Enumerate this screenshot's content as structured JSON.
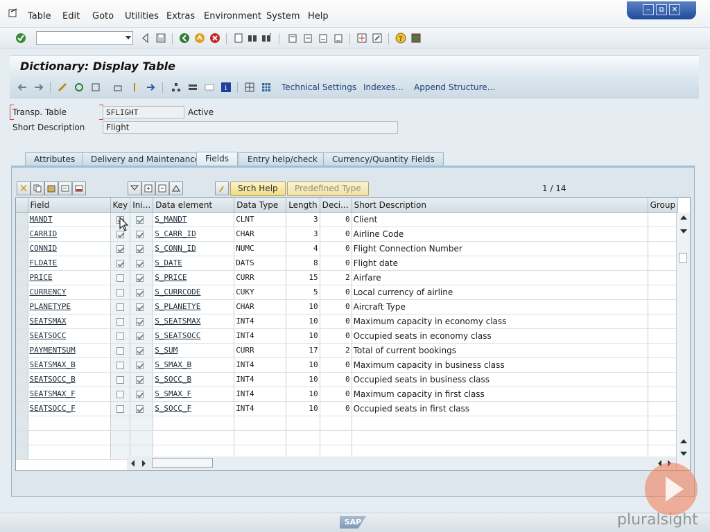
{
  "menu": [
    "Table",
    "Edit",
    "Goto",
    "Utilities",
    "Extras",
    "Environment",
    "System",
    "Help"
  ],
  "window_controls": [
    "‒",
    "⧉",
    "✕"
  ],
  "page_title": "Dictionary: Display Table",
  "app_toolbar": {
    "technical_settings": "Technical Settings",
    "indexes": "Indexes...",
    "append_structure": "Append Structure..."
  },
  "header": {
    "table_type_label": "Transp. Table",
    "table_name": "SFLIGHT",
    "status": "Active",
    "short_desc_label": "Short Description",
    "short_desc": "Flight"
  },
  "tabs": [
    "Attributes",
    "Delivery and Maintenance",
    "Fields",
    "Entry help/check",
    "Currency/Quantity Fields"
  ],
  "active_tab": "Fields",
  "grid_buttons": {
    "search_help": "Srch Help",
    "predefined_type": "Predefined Type"
  },
  "pager": "1 / 14",
  "columns": [
    "Field",
    "Key",
    "Ini...",
    "Data element",
    "Data Type",
    "Length",
    "Deci...",
    "Short Description",
    "Group"
  ],
  "rows": [
    {
      "field": "MANDT",
      "key": true,
      "init": true,
      "element": "S_MANDT",
      "type": "CLNT",
      "length": "3",
      "dec": "0",
      "desc": "Client"
    },
    {
      "field": "CARRID",
      "key": true,
      "init": true,
      "element": "S_CARR_ID",
      "type": "CHAR",
      "length": "3",
      "dec": "0",
      "desc": "Airline Code"
    },
    {
      "field": "CONNID",
      "key": true,
      "init": true,
      "element": "S_CONN_ID",
      "type": "NUMC",
      "length": "4",
      "dec": "0",
      "desc": "Flight Connection Number"
    },
    {
      "field": "FLDATE",
      "key": true,
      "init": true,
      "element": "S_DATE",
      "type": "DATS",
      "length": "8",
      "dec": "0",
      "desc": "Flight date"
    },
    {
      "field": "PRICE",
      "key": false,
      "init": true,
      "element": "S_PRICE",
      "type": "CURR",
      "length": "15",
      "dec": "2",
      "desc": "Airfare"
    },
    {
      "field": "CURRENCY",
      "key": false,
      "init": true,
      "element": "S_CURRCODE",
      "type": "CUKY",
      "length": "5",
      "dec": "0",
      "desc": "Local currency of airline"
    },
    {
      "field": "PLANETYPE",
      "key": false,
      "init": true,
      "element": "S_PLANETYE",
      "type": "CHAR",
      "length": "10",
      "dec": "0",
      "desc": "Aircraft Type"
    },
    {
      "field": "SEATSMAX",
      "key": false,
      "init": true,
      "element": "S_SEATSMAX",
      "type": "INT4",
      "length": "10",
      "dec": "0",
      "desc": "Maximum capacity in economy class"
    },
    {
      "field": "SEATSOCC",
      "key": false,
      "init": true,
      "element": "S_SEATSOCC",
      "type": "INT4",
      "length": "10",
      "dec": "0",
      "desc": "Occupied seats in economy class"
    },
    {
      "field": "PAYMENTSUM",
      "key": false,
      "init": true,
      "element": "S_SUM",
      "type": "CURR",
      "length": "17",
      "dec": "2",
      "desc": "Total of current bookings"
    },
    {
      "field": "SEATSMAX_B",
      "key": false,
      "init": true,
      "element": "S_SMAX_B",
      "type": "INT4",
      "length": "10",
      "dec": "0",
      "desc": "Maximum capacity in business class"
    },
    {
      "field": "SEATSOCC_B",
      "key": false,
      "init": true,
      "element": "S_SOCC_B",
      "type": "INT4",
      "length": "10",
      "dec": "0",
      "desc": "Occupied seats in business class"
    },
    {
      "field": "SEATSMAX_F",
      "key": false,
      "init": true,
      "element": "S_SMAX_F",
      "type": "INT4",
      "length": "10",
      "dec": "0",
      "desc": "Maximum capacity in first class"
    },
    {
      "field": "SEATSOCC_F",
      "key": false,
      "init": true,
      "element": "S_SOCC_F",
      "type": "INT4",
      "length": "10",
      "dec": "0",
      "desc": "Occupied seats in first class"
    }
  ],
  "empty_rows": 3,
  "footer": {
    "sap_logo": "SAP",
    "watermark": "pluralsight"
  }
}
